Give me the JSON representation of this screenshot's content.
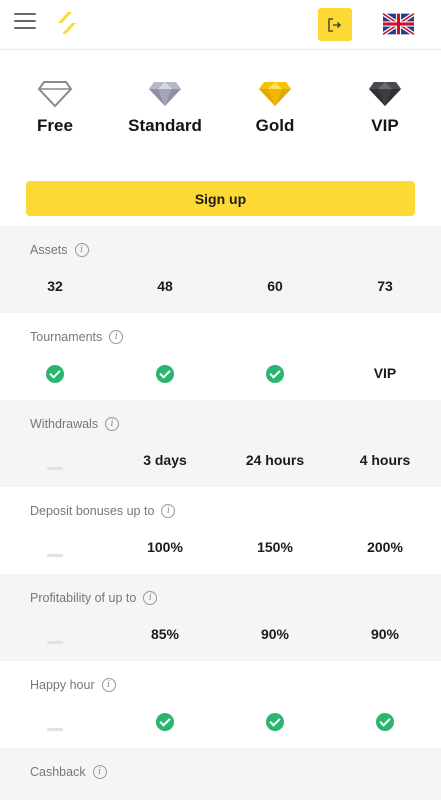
{
  "header": {
    "menu_icon": "hamburger-menu-icon",
    "logo_icon": "logo-icon",
    "login_icon": "login-exit-icon",
    "flag_icon": "uk-flag-icon",
    "accent": "#fcd935"
  },
  "tiers": [
    {
      "label": "Free",
      "icon": "diamond-outline-icon"
    },
    {
      "label": "Standard",
      "icon": "diamond-silver-icon"
    },
    {
      "label": "Gold",
      "icon": "diamond-gold-icon"
    },
    {
      "label": "VIP",
      "icon": "diamond-dark-icon"
    }
  ],
  "signup_label": "Sign up",
  "features": [
    {
      "title": "Assets",
      "values": [
        "32",
        "48",
        "60",
        "73"
      ]
    },
    {
      "title": "Tournaments",
      "values": [
        "check",
        "check",
        "check",
        "VIP"
      ]
    },
    {
      "title": "Withdrawals",
      "values": [
        "dash",
        "3 days",
        "24 hours",
        "4 hours"
      ]
    },
    {
      "title": "Deposit bonuses up to",
      "values": [
        "dash",
        "100%",
        "150%",
        "200%"
      ]
    },
    {
      "title": "Profitability of up to",
      "values": [
        "dash",
        "85%",
        "90%",
        "90%"
      ]
    },
    {
      "title": "Happy hour",
      "values": [
        "dash",
        "check",
        "check",
        "check"
      ]
    },
    {
      "title": "Cashback",
      "values": []
    }
  ],
  "colors": {
    "check_green": "#2cb56e",
    "row_alt": "#f4f5f5"
  }
}
